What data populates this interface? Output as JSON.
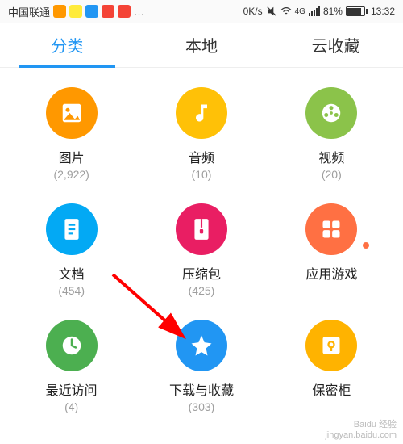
{
  "status": {
    "carrier": "中国联通",
    "speed": "0K/s",
    "network": "4G",
    "battery_pct": "81%",
    "time": "13:32"
  },
  "tabs": {
    "t0": "分类",
    "t1": "本地",
    "t2": "云收藏"
  },
  "categories": {
    "images": {
      "label": "图片",
      "count": "(2,922)",
      "color": "#ff9800"
    },
    "audio": {
      "label": "音频",
      "count": "(10)",
      "color": "#ffc107"
    },
    "video": {
      "label": "视频",
      "count": "(20)",
      "color": "#8bc34a"
    },
    "docs": {
      "label": "文档",
      "count": "(454)",
      "color": "#03a9f4"
    },
    "archive": {
      "label": "压缩包",
      "count": "(425)",
      "color": "#e91e63"
    },
    "apps": {
      "label": "应用游戏",
      "count": "",
      "color": "#ff7043"
    },
    "recent": {
      "label": "最近访问",
      "count": "(4)",
      "color": "#4caf50"
    },
    "download": {
      "label": "下载与收藏",
      "count": "(303)",
      "color": "#2196f3"
    },
    "safe": {
      "label": "保密柜",
      "count": "",
      "color": "#ffb300"
    }
  },
  "watermark": {
    "brand": "Baidu 经验",
    "url": "jingyan.baidu.com"
  }
}
